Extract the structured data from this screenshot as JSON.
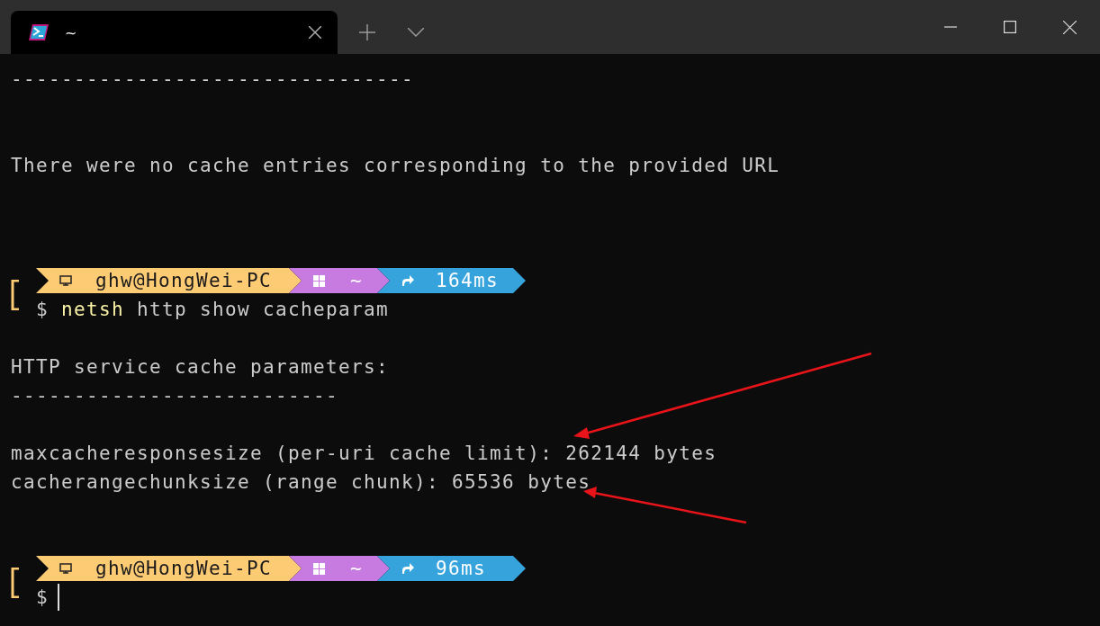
{
  "window": {
    "tab": {
      "title": "~",
      "selected": true
    }
  },
  "terminal": {
    "lines": [
      {
        "kind": "text",
        "text": "--------------------------------"
      },
      {
        "kind": "blank"
      },
      {
        "kind": "blank"
      },
      {
        "kind": "text",
        "text": "There were no cache entries corresponding to the provided URL"
      },
      {
        "kind": "blank"
      },
      {
        "kind": "blank"
      },
      {
        "kind": "blank"
      },
      {
        "kind": "prompt",
        "user": "ghw@HongWei-PC",
        "path": "~",
        "duration": "164ms",
        "symbol": "$",
        "command": "netsh",
        "args": "http show cacheparam",
        "cursor": false
      },
      {
        "kind": "blank"
      },
      {
        "kind": "text",
        "text": "HTTP service cache parameters:"
      },
      {
        "kind": "text",
        "text": "--------------------------"
      },
      {
        "kind": "blank"
      },
      {
        "kind": "text",
        "text": "maxcacheresponsesize (per-uri cache limit): 262144 bytes"
      },
      {
        "kind": "text",
        "text": "cacherangechunksize (range chunk): 65536 bytes"
      },
      {
        "kind": "blank"
      },
      {
        "kind": "blank"
      },
      {
        "kind": "prompt",
        "user": "ghw@HongWei-PC",
        "path": "~",
        "duration": "96ms",
        "symbol": "$",
        "cursor": true
      }
    ]
  }
}
